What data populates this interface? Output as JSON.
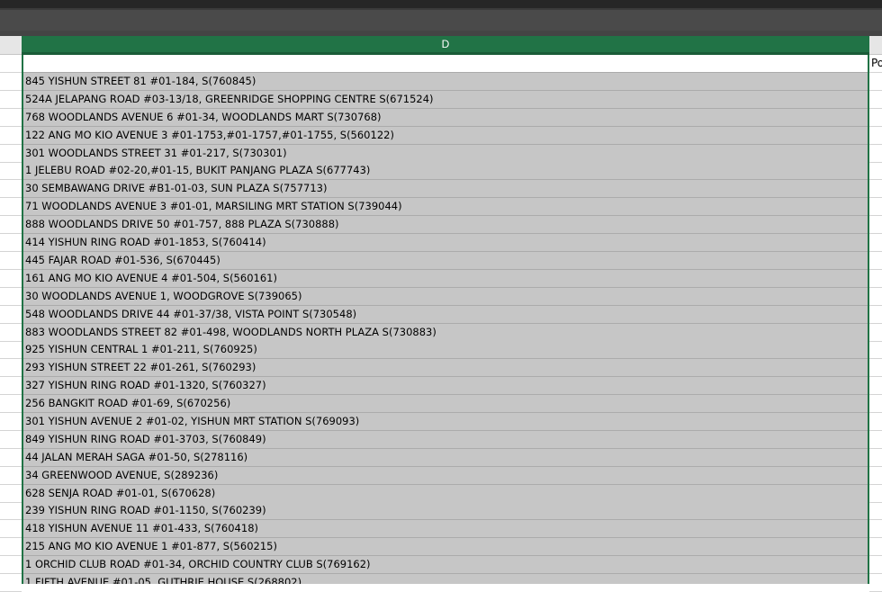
{
  "sheet": {
    "selected_column_header": "D",
    "next_column_partial_text": "Po",
    "column_d_rows": [
      "",
      "845 YISHUN STREET 81 #01-184, S(760845)",
      "524A JELAPANG ROAD #03-13/18, GREENRIDGE SHOPPING CENTRE S(671524)",
      "768 WOODLANDS AVENUE 6 #01-34, WOODLANDS MART S(730768)",
      "122 ANG MO KIO AVENUE 3 #01-1753,#01-1757,#01-1755, S(560122)",
      "301 WOODLANDS STREET 31 #01-217, S(730301)",
      "1 JELEBU ROAD #02-20,#01-15, BUKIT PANJANG PLAZA S(677743)",
      "30 SEMBAWANG DRIVE #B1-01-03, SUN PLAZA S(757713)",
      "71 WOODLANDS AVENUE 3 #01-01, MARSILING MRT STATION S(739044)",
      "888 WOODLANDS DRIVE 50 #01-757, 888 PLAZA S(730888)",
      "414 YISHUN RING ROAD #01-1853, S(760414)",
      "445 FAJAR ROAD #01-536, S(670445)",
      "161 ANG MO KIO AVENUE 4 #01-504, S(560161)",
      "30 WOODLANDS AVENUE 1, WOODGROVE S(739065)",
      "548 WOODLANDS DRIVE 44 #01-37/38, VISTA POINT S(730548)",
      "883 WOODLANDS STREET 82 #01-498, WOODLANDS NORTH PLAZA S(730883)",
      "925 YISHUN CENTRAL 1 #01-211, S(760925)",
      "293 YISHUN STREET 22 #01-261, S(760293)",
      "327 YISHUN RING ROAD #01-1320, S(760327)",
      "256 BANGKIT ROAD #01-69, S(670256)",
      "301 YISHUN AVENUE 2 #01-02, YISHUN MRT STATION S(769093)",
      "849 YISHUN RING ROAD #01-3703, S(760849)",
      "44 JALAN MERAH SAGA #01-50, S(278116)",
      "34 GREENWOOD AVENUE, S(289236)",
      "628 SENJA ROAD #01-01, S(670628)",
      "239 YISHUN RING ROAD #01-1150, S(760239)",
      "418 YISHUN AVENUE 11 #01-433, S(760418)",
      "215 ANG MO KIO AVENUE 1 #01-877, S(560215)",
      "1 ORCHID CLUB ROAD #01-34, ORCHID COUNTRY CLUB S(769162)",
      "1 FIFTH AVENUE #01-05, GUTHRIE HOUSE S(268802)"
    ]
  },
  "colors": {
    "selection_green": "#217346",
    "selected_cell_fill": "#c6c6c6",
    "toolbar_dark": "#4a4a4a"
  }
}
